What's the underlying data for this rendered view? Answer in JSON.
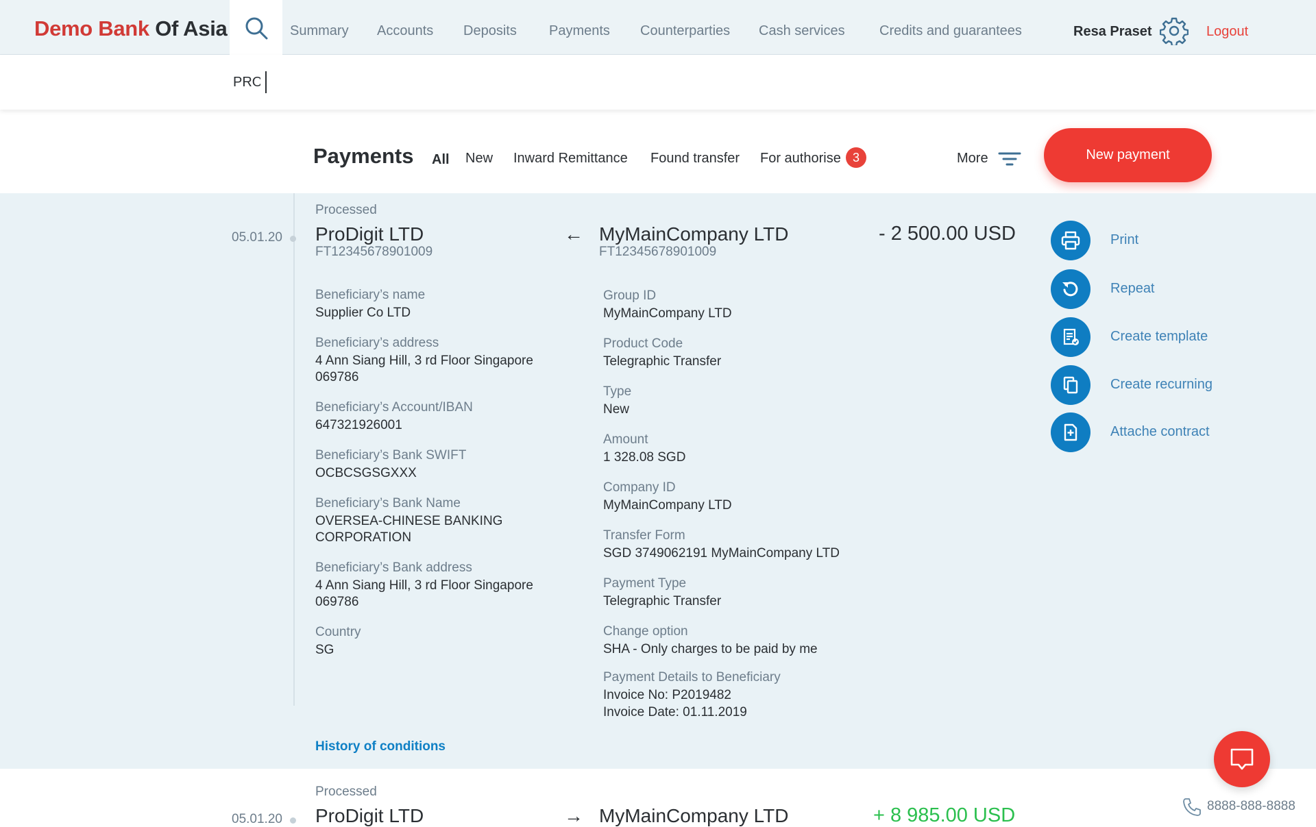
{
  "header": {
    "logo_part1": "Demo Bank",
    "logo_part2": "Of Asia",
    "nav": [
      "Summary",
      "Accounts",
      "Deposits",
      "Payments",
      "Counterparties",
      "Cash services",
      "Credits and guarantees"
    ],
    "user_name": "Resa Praset",
    "logout_label": "Logout"
  },
  "search": {
    "value": "PRO"
  },
  "payments": {
    "title": "Payments",
    "tabs": [
      "All",
      "New",
      "Inward Remittance",
      "Found transfer",
      "For authorise"
    ],
    "active_tab": "All",
    "authorise_count": "3",
    "more_label": "More",
    "new_payment_label": "New payment"
  },
  "records": [
    {
      "date": "05.01.20",
      "status": "Processed",
      "from_name": "ProDigit LTD",
      "from_ref": "FT12345678901009",
      "direction": "←",
      "to_name": "MyMainCompany LTD",
      "to_ref": "FT12345678901009",
      "amount": "- 2 500.00 USD",
      "left_fields": [
        {
          "label": "Beneficiary’s name",
          "value": "Supplier Co LTD"
        },
        {
          "label": "Beneficiary’s address",
          "value": "4 Ann Siang Hill, 3 rd Floor Singapore 069786"
        },
        {
          "label": "Beneficiary’s Account/IBAN",
          "value": "647321926001"
        },
        {
          "label": "Beneficiary’s Bank SWIFT",
          "value": "OCBCSGSGXXX"
        },
        {
          "label": "Beneficiary’s Bank Name",
          "value": "OVERSEA-CHINESE BANKING CORPORATION"
        },
        {
          "label": "Beneficiary’s Bank address",
          "value": "4 Ann Siang Hill, 3 rd Floor Singapore 069786"
        },
        {
          "label": "Country",
          "value": "SG"
        }
      ],
      "right_fields": [
        {
          "label": "Group ID",
          "value": "MyMainCompany LTD"
        },
        {
          "label": "Product Code",
          "value": "Telegraphic Transfer"
        },
        {
          "label": "Type",
          "value": "New"
        },
        {
          "label": "Amount",
          "value": "1 328.08 SGD"
        },
        {
          "label": "Company ID",
          "value": "MyMainCompany LTD"
        },
        {
          "label": "Transfer Form",
          "value": "SGD 3749062191 MyMainCompany LTD"
        },
        {
          "label": "Payment Type",
          "value": "Telegraphic Transfer"
        },
        {
          "label": "Change option",
          "value": "SHA - Only charges to be paid by me"
        },
        {
          "label": "Payment Details to Beneficiary",
          "value": "Invoice No: P2019482",
          "value2": "Invoice Date: 01.11.2019"
        }
      ],
      "history_label": "History of conditions"
    },
    {
      "date": "05.01.20",
      "status": "Processed",
      "from_name": "ProDigit LTD",
      "direction": "→",
      "to_name": "MyMainCompany LTD",
      "amount": "+ 8 985.00 USD"
    }
  ],
  "actions": [
    {
      "label": "Print",
      "icon": "printer-icon"
    },
    {
      "label": "Repeat",
      "icon": "repeat-icon"
    },
    {
      "label": "Create template",
      "icon": "template-icon"
    },
    {
      "label": "Create recurning",
      "icon": "copy-icon"
    },
    {
      "label": "Attache contract",
      "icon": "attach-document-icon"
    }
  ],
  "support": {
    "phone": "8888-888-8888"
  },
  "colors": {
    "accent_red": "#ee3a33",
    "primary_blue": "#0f7dc2",
    "background": "#e9f2f6"
  }
}
